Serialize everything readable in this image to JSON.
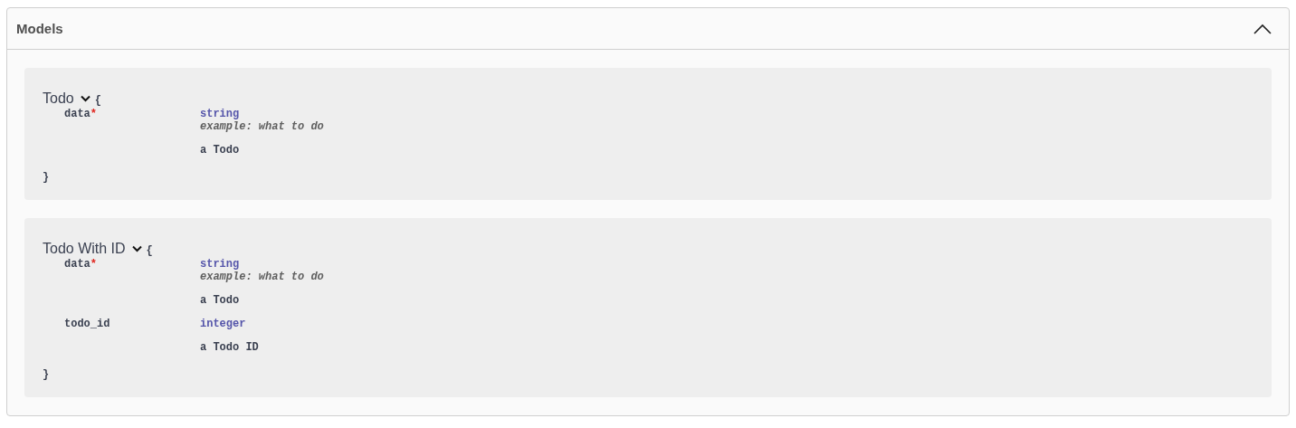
{
  "section": {
    "title": "Models",
    "expanded": true
  },
  "models": [
    {
      "name": "Todo",
      "expanded": true,
      "open_brace": "{",
      "close_brace": "}",
      "properties": [
        {
          "name": "data",
          "required_mark": "*",
          "type": "string",
          "example": "example: what to do",
          "description": "a Todo"
        }
      ]
    },
    {
      "name": "Todo With ID",
      "expanded": true,
      "open_brace": "{",
      "close_brace": "}",
      "properties": [
        {
          "name": "data",
          "required_mark": "*",
          "type": "string",
          "example": "example: what to do",
          "description": "a Todo"
        },
        {
          "name": "todo_id",
          "type": "integer",
          "description": "a Todo ID"
        }
      ]
    }
  ]
}
